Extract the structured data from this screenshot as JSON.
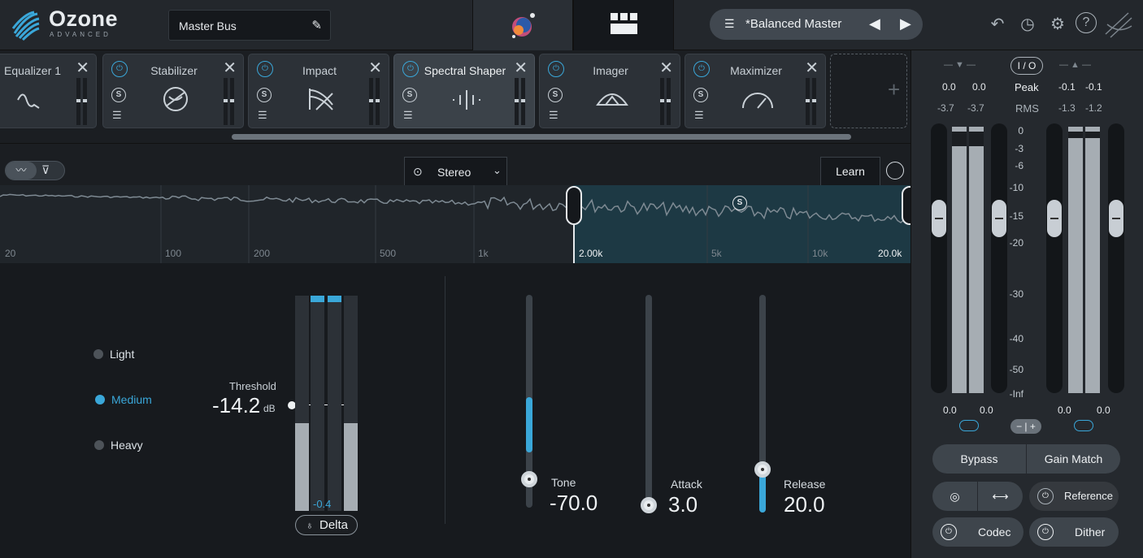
{
  "app": {
    "logo": "Ozone",
    "logo_sub": "ADVANCED",
    "preset_name": "Master Bus",
    "preset": "*Balanced Master"
  },
  "modules": [
    {
      "name": "Equalizer 1",
      "selected": false
    },
    {
      "name": "Stabilizer",
      "selected": false
    },
    {
      "name": "Impact",
      "selected": false
    },
    {
      "name": "Spectral Shaper",
      "selected": true
    },
    {
      "name": "Imager",
      "selected": false
    },
    {
      "name": "Maximizer",
      "selected": false
    }
  ],
  "toolbar": {
    "stereo_label": "Stereo",
    "learn_label": "Learn"
  },
  "spectrum": {
    "freq_labels": [
      "20",
      "100",
      "200",
      "500",
      "1k",
      "2.00k",
      "5k",
      "10k",
      "20.0k"
    ],
    "band_low": "2.00k",
    "band_high": "20.0k"
  },
  "modes": {
    "items": [
      "Light",
      "Medium",
      "Heavy"
    ],
    "selected": "Medium"
  },
  "threshold": {
    "label": "Threshold",
    "value": "-14.2",
    "unit": "dB"
  },
  "meter": {
    "reading": "-0.4",
    "delta_label": "Delta"
  },
  "params": {
    "tone": {
      "label": "Tone",
      "value": "-70.0",
      "fill_percent": 52
    },
    "attack": {
      "label": "Attack",
      "value": "3.0",
      "fill_percent": 0
    },
    "release": {
      "label": "Release",
      "value": "20.0",
      "fill_percent": 20
    }
  },
  "io": {
    "io_label": "I / O",
    "peak_label": "Peak",
    "rms_label": "RMS",
    "in_peak": [
      "0.0",
      "0.0"
    ],
    "in_rms": [
      "-3.7",
      "-3.7"
    ],
    "out_peak": [
      "-0.1",
      "-0.1"
    ],
    "out_rms": [
      "-1.3",
      "-1.2"
    ],
    "scale": [
      "0",
      "-3",
      "-6",
      "-10",
      "-15",
      "-20",
      "-30",
      "-40",
      "-50",
      "-Inf"
    ],
    "in_fader": [
      "0.0",
      "0.0"
    ],
    "out_fader": [
      "0.0",
      "0.0"
    ]
  },
  "buttons": {
    "bypass": "Bypass",
    "gain_match": "Gain Match",
    "reference": "Reference",
    "codec": "Codec",
    "dither": "Dither"
  }
}
